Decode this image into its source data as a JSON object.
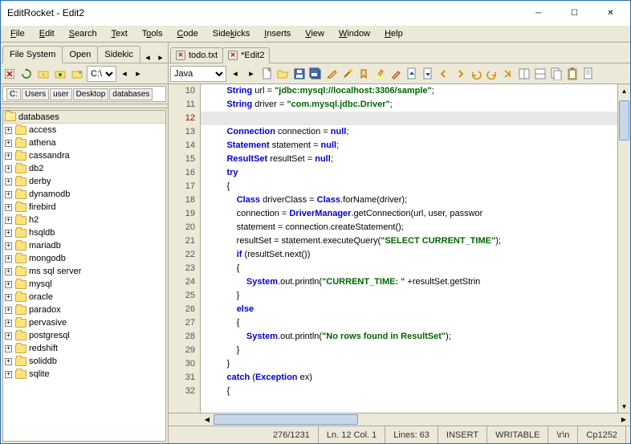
{
  "window": {
    "title": "EditRocket - Edit2"
  },
  "menubar": [
    {
      "label": "File",
      "u": 0
    },
    {
      "label": "Edit",
      "u": 0
    },
    {
      "label": "Search",
      "u": 0
    },
    {
      "label": "Text",
      "u": 0
    },
    {
      "label": "Tools",
      "u": 1
    },
    {
      "label": "Code",
      "u": 0
    },
    {
      "label": "Sidekicks",
      "u": 4
    },
    {
      "label": "Inserts",
      "u": 0
    },
    {
      "label": "View",
      "u": 0
    },
    {
      "label": "Window",
      "u": 0
    },
    {
      "label": "Help",
      "u": 0
    }
  ],
  "sidebar": {
    "tabs": [
      "File System",
      "Open",
      "Sidekic"
    ],
    "active_tab": 0,
    "drive": "C:\\",
    "path_segments": [
      "C:",
      "Users",
      "user",
      "Desktop",
      "databases"
    ],
    "root_folder": "databases",
    "folders": [
      "access",
      "athena",
      "cassandra",
      "db2",
      "derby",
      "dynamodb",
      "firebird",
      "h2",
      "hsqldb",
      "mariadb",
      "mongodb",
      "ms sql server",
      "mysql",
      "oracle",
      "paradox",
      "pervasive",
      "postgresql",
      "redshift",
      "soliddb",
      "sqlite"
    ]
  },
  "editor": {
    "tabs": [
      {
        "label": "todo.txt",
        "dirty": false
      },
      {
        "label": "*Edit2",
        "dirty": true
      }
    ],
    "active_tab": 1,
    "language": "Java",
    "first_line": 10,
    "current_line": 12,
    "lines": [
      {
        "n": 10,
        "html": "        <span class='kw'>String</span> url = <span class='str'>\"jdbc:mysql://localhost:3306/sample\"</span>;"
      },
      {
        "n": 11,
        "html": "        <span class='kw'>String</span> driver = <span class='str'>\"com.mysql.jdbc.Driver\"</span>;"
      },
      {
        "n": 12,
        "html": ""
      },
      {
        "n": 13,
        "html": "        <span class='cls'>Connection</span> connection = <span class='kw'>null</span>;"
      },
      {
        "n": 14,
        "html": "        <span class='cls'>Statement</span> statement = <span class='kw'>null</span>;"
      },
      {
        "n": 15,
        "html": "        <span class='cls'>ResultSet</span> resultSet = <span class='kw'>null</span>;"
      },
      {
        "n": 16,
        "html": "        <span class='kw'>try</span>"
      },
      {
        "n": 17,
        "html": "        {"
      },
      {
        "n": 18,
        "html": "            <span class='cls'>Class</span> driverClass = <span class='cls'>Class</span>.forName(driver);"
      },
      {
        "n": 19,
        "html": "            connection = <span class='cls'>DriverManager</span>.getConnection(url, user, passwor"
      },
      {
        "n": 20,
        "html": "            statement = connection.createStatement();"
      },
      {
        "n": 21,
        "html": "            resultSet = statement.executeQuery(<span class='str'>\"SELECT CURRENT_TIME\"</span>);"
      },
      {
        "n": 22,
        "html": "            <span class='kw'>if</span> (resultSet.next())"
      },
      {
        "n": 23,
        "html": "            {"
      },
      {
        "n": 24,
        "html": "                <span class='cls'>System</span>.out.println(<span class='str'>\"CURRENT_TIME: \"</span> +resultSet.getStrin"
      },
      {
        "n": 25,
        "html": "            }"
      },
      {
        "n": 26,
        "html": "            <span class='kw'>else</span>"
      },
      {
        "n": 27,
        "html": "            {"
      },
      {
        "n": 28,
        "html": "                <span class='cls'>System</span>.out.println(<span class='str'>\"No rows found in ResultSet\"</span>);"
      },
      {
        "n": 29,
        "html": "            }"
      },
      {
        "n": 30,
        "html": "        }"
      },
      {
        "n": 31,
        "html": "        <span class='kw'>catch</span> (<span class='cls'>Exception</span> ex)"
      },
      {
        "n": 32,
        "html": "        {"
      }
    ]
  },
  "statusbar": {
    "pos": "276/1231",
    "lncol": "Ln. 12 Col. 1",
    "lines": "Lines: 63",
    "mode": "INSERT",
    "perm": "WRITABLE",
    "eol": "\\r\\n",
    "enc": "Cp1252"
  }
}
